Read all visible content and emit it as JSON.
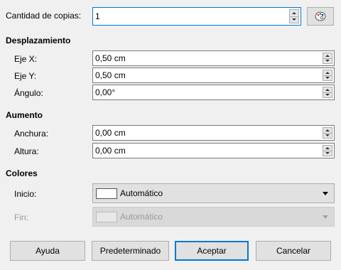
{
  "copies": {
    "label": "Cantidad de copias:",
    "value": "1",
    "palette_icon": "palette-icon"
  },
  "displacement": {
    "heading": "Desplazamiento",
    "x_label": "Eje X:",
    "x_value": "0,50 cm",
    "y_label": "Eje Y:",
    "y_value": "0,50 cm",
    "angle_label": "Ángulo:",
    "angle_value": "0,00°"
  },
  "enlargement": {
    "heading": "Aumento",
    "width_label": "Anchura:",
    "width_value": "0,00 cm",
    "height_label": "Altura:",
    "height_value": "0,00 cm"
  },
  "colors": {
    "heading": "Colores",
    "start_label": "Inicio:",
    "start_value": "Automático",
    "end_label": "Fin:",
    "end_value": "Automático"
  },
  "buttons": {
    "help": "Ayuda",
    "reset": "Predeterminado",
    "ok": "Aceptar",
    "cancel": "Cancelar"
  },
  "accent_color": "#0078d7"
}
